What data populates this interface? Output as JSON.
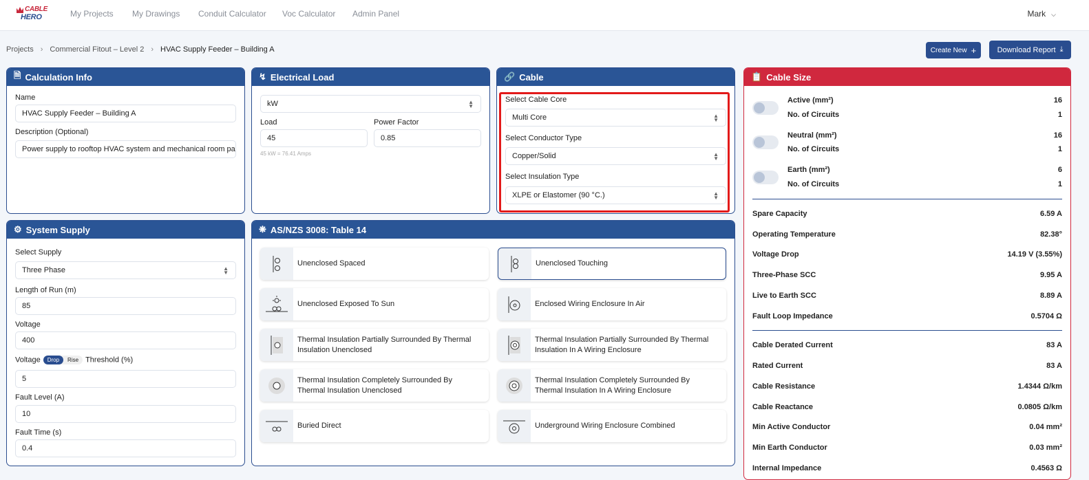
{
  "nav": {
    "links": [
      "My Projects",
      "My Drawings",
      "Conduit Calculator",
      "Voc Calculator",
      "Admin Panel"
    ],
    "user": "Mark",
    "logo_top": "CABLE",
    "logo_bottom": "HERO"
  },
  "breadcrumb": [
    "Projects",
    "Commercial Fitout – Level 2",
    "HVAC Supply Feeder – Building A"
  ],
  "actions": {
    "create": "Create New",
    "download": "Download Report"
  },
  "calc_info": {
    "title": "Calculation Info",
    "name_label": "Name",
    "name_value": "HVAC Supply Feeder – Building A",
    "desc_label": "Description (Optional)",
    "desc_value": "Power supply to rooftop HVAC system and mechanical room panel;"
  },
  "load": {
    "title": "Electrical Load",
    "unit": "kW",
    "load_label": "Load",
    "load_value": "45",
    "pf_label": "Power Factor",
    "pf_value": "0.85",
    "hint": "45 kW = 76.41 Amps"
  },
  "cable": {
    "title": "Cable",
    "core_label": "Select Cable Core",
    "core_value": "Multi Core",
    "conductor_label": "Select Conductor Type",
    "conductor_value": "Copper/Solid",
    "insulation_label": "Select Insulation Type",
    "insulation_value": "XLPE or Elastomer (90 °C.)"
  },
  "supply": {
    "title": "System Supply",
    "supply_label": "Select Supply",
    "supply_value": "Three Phase",
    "length_label": "Length of Run (m)",
    "length_value": "85",
    "voltage_label": "Voltage",
    "voltage_value": "400",
    "threshold_prefix": "Voltage",
    "drop": "Drop",
    "rise": "Rise",
    "threshold_suffix": "Threshold (%)",
    "threshold_value": "5",
    "fault_level_label": "Fault Level (A)",
    "fault_level_value": "10",
    "fault_time_label": "Fault Time (s)",
    "fault_time_value": "0.4"
  },
  "table": {
    "title": "AS/NZS 3008: Table 14",
    "items": [
      "Unenclosed Spaced",
      "Unenclosed Touching",
      "Unenclosed Exposed To Sun",
      "Enclosed Wiring Enclosure In Air",
      "Thermal Insulation Partially Surrounded By Thermal Insulation Unenclosed",
      "Thermal Insulation Partially Surrounded By Thermal Insulation In A Wiring Enclosure",
      "Thermal Insulation Completely Surrounded By Thermal Insulation Unenclosed",
      "Thermal Insulation Completely Surrounded By Thermal Insulation In A Wiring Enclosure",
      "Buried Direct",
      "Underground Wiring Enclosure Combined"
    ],
    "selected_index": 1
  },
  "cable_size": {
    "title": "Cable Size",
    "conductors": [
      {
        "label": "Active (mm²)",
        "value": "16",
        "circuits_label": "No. of Circuits",
        "circuits": "1"
      },
      {
        "label": "Neutral (mm²)",
        "value": "16",
        "circuits_label": "No. of Circuits",
        "circuits": "1"
      },
      {
        "label": "Earth (mm²)",
        "value": "6",
        "circuits_label": "No. of Circuits",
        "circuits": "1"
      }
    ],
    "results_a": [
      {
        "label": "Spare Capacity",
        "value": "6.59 A"
      },
      {
        "label": "Operating Temperature",
        "value": "82.38°"
      },
      {
        "label": "Voltage Drop",
        "value": "14.19 V (3.55%)"
      },
      {
        "label": "Three-Phase SCC",
        "value": "9.95 A"
      },
      {
        "label": "Live to Earth SCC",
        "value": "8.89 A"
      },
      {
        "label": "Fault Loop Impedance",
        "value": "0.5704 Ω"
      }
    ],
    "results_b": [
      {
        "label": "Cable Derated Current",
        "value": "83 A"
      },
      {
        "label": "Rated Current",
        "value": "83 A"
      },
      {
        "label": "Cable Resistance",
        "value": "1.4344 Ω/km"
      },
      {
        "label": "Cable Reactance",
        "value": "0.0805 Ω/km"
      },
      {
        "label": "Min Active Conductor",
        "value": "0.04 mm²"
      },
      {
        "label": "Min Earth Conductor",
        "value": "0.03 mm²"
      },
      {
        "label": "Internal Impedance",
        "value": "0.4563 Ω"
      }
    ]
  }
}
